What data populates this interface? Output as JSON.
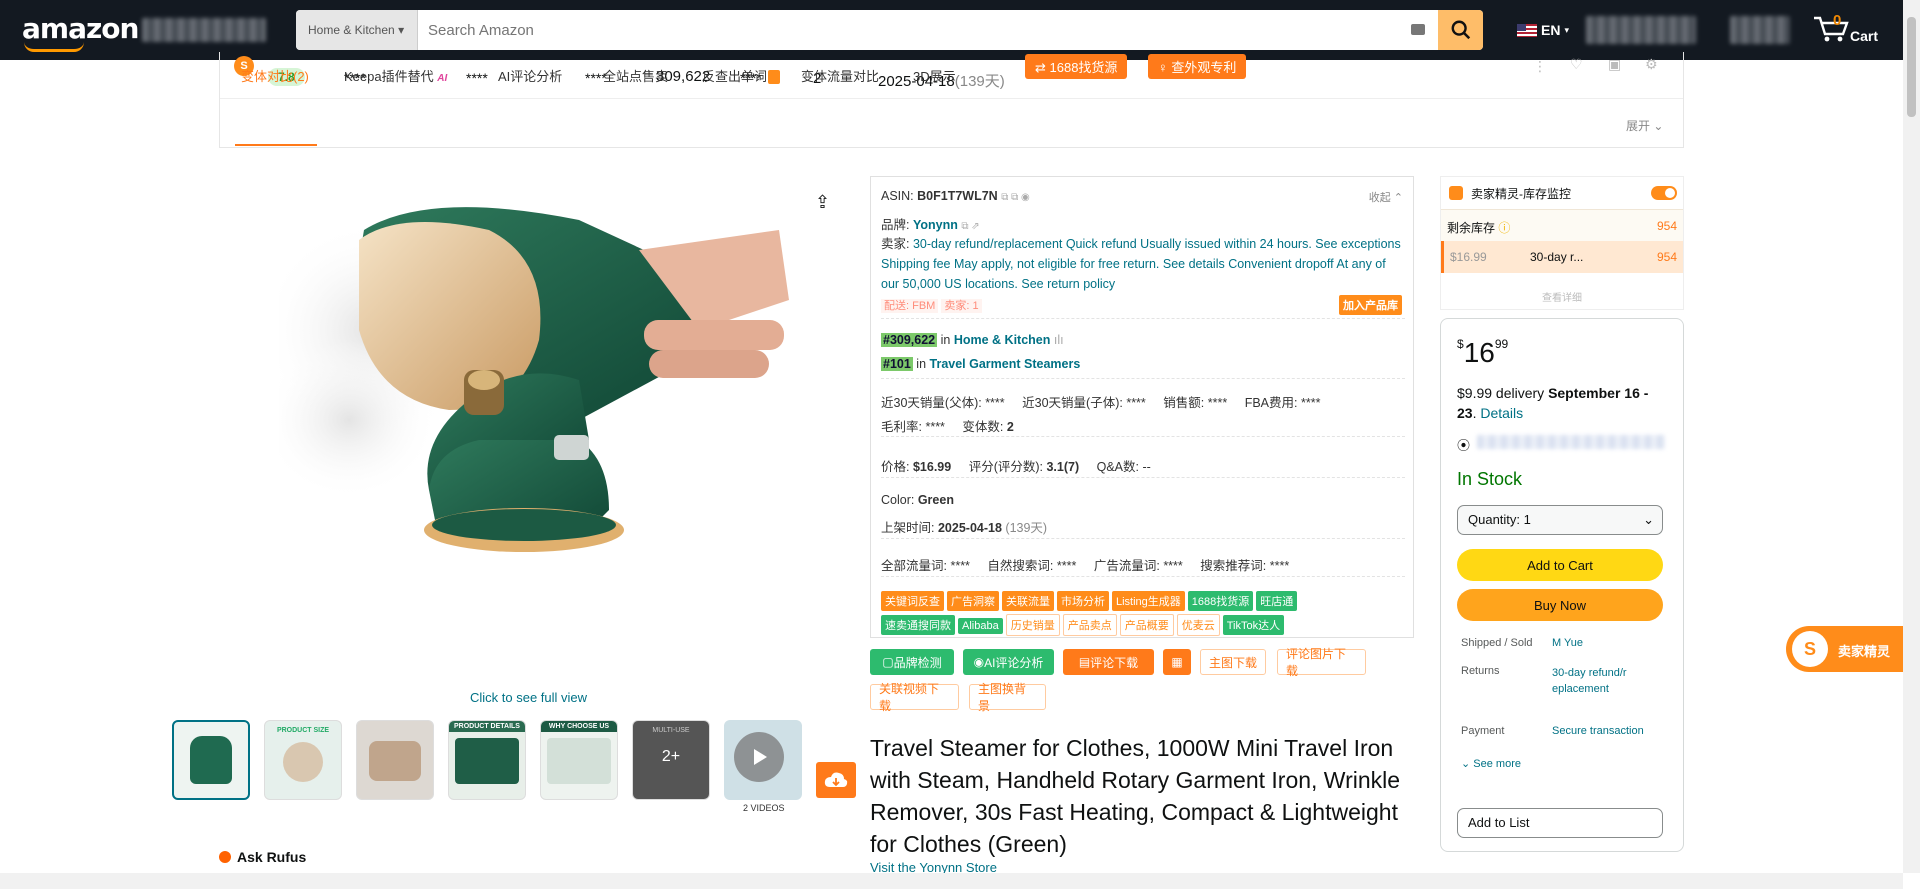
{
  "nav": {
    "logo": "amazon",
    "search_category": "Home & Kitchen",
    "search_placeholder": "Search Amazon",
    "language": "EN",
    "cart_count": "0",
    "cart_label": "Cart"
  },
  "plugin": {
    "score": "7.8",
    "stats": [
      "****",
      "****",
      "****",
      "309,622",
      "****",
      "2",
      "2025-04-18"
    ],
    "days_ago": "(139天)",
    "btn_1688": "1688找货源",
    "btn_patent": "查外观专利",
    "tabs": [
      "变体对比(2)",
      "Keepa插件替代",
      "AI评论分析",
      "全站点售卖",
      "反查出单词",
      "变体流量对比",
      "3D展示"
    ],
    "ai_badge": "AI",
    "expand": "展开"
  },
  "gallery": {
    "see_full": "Click to see full view",
    "thumbs": [
      "",
      "PRODUCT SIZE",
      "",
      "PRODUCT DETAILS",
      "WHY CHOOSE US",
      "MULTI-USE"
    ],
    "more": "2+",
    "videos": "2 VIDEOS",
    "ask_rufus": "Ask Rufus"
  },
  "info": {
    "asin_label": "ASIN:",
    "asin": "B0F1T7WL7N",
    "collapse": "收起",
    "brand_label": "品牌:",
    "brand": "Yonynn",
    "seller_label": "卖家:",
    "seller_text": "30-day refund/replacement Quick refund Usually issued within 24 hours. See exceptions Shipping fee May apply, not eligible for free return. See details Convenient dropoff At any of our 50,000 US locations. See return policy",
    "fulfill": "配送: FBM",
    "seller_count": "卖家: 1",
    "add_lib": "加入产品库",
    "rank1": "#309,622",
    "rank1_in": "in",
    "rank1_cat": "Home & Kitchen",
    "rank2": "#101",
    "rank2_in": "in",
    "rank2_cat": "Travel Garment Steamers",
    "sales_parent_label": "近30天销量(父体):",
    "sales_parent": "****",
    "sales_child_label": "近30天销量(子体):",
    "sales_child": "****",
    "revenue_label": "销售额:",
    "revenue": "****",
    "fba_label": "FBA费用:",
    "fba": "****",
    "margin_label": "毛利率:",
    "margin": "****",
    "variants_label": "变体数:",
    "variants": "2",
    "price_label": "价格:",
    "price": "$16.99",
    "rating_label": "评分(评分数):",
    "rating": "3.1(7)",
    "qa_label": "Q&A数:",
    "qa": "--",
    "color_label": "Color:",
    "color": "Green",
    "listed_label": "上架时间:",
    "listed": "2025-04-18",
    "listed_days": "(139天)",
    "all_traffic_label": "全部流量词:",
    "all_traffic": "****",
    "organic_label": "自然搜索词:",
    "organic": "****",
    "ad_label": "广告流量词:",
    "ad": "****",
    "rec_label": "搜索推荐词:",
    "rec": "****",
    "tags_row1": [
      "关键词反查",
      "广告洞察",
      "关联流量",
      "市场分析",
      "Listing生成器",
      "1688找货源",
      "旺店通"
    ],
    "tags_row2": [
      "速卖通搜同款",
      "Alibaba",
      "历史销量",
      "产品卖点",
      "产品概要",
      "优麦云",
      "TikTok达人"
    ]
  },
  "actions": {
    "brand_check": "品牌检测",
    "ai_review": "AI评论分析",
    "review_dl": "评论下载",
    "main_img_dl": "主图下载",
    "review_img_dl": "评论图片下载",
    "video_dl": "关联视频下载",
    "bg_swap": "主图换背景"
  },
  "product": {
    "title": "Travel Steamer for Clothes, 1000W Mini Travel Iron with Steam, Handheld Rotary Garment Iron, Wrinkle Remover, 30s Fast Heating, Compact & Lightweight for Clothes (Green)",
    "store_link": "Visit the Yonynn Store"
  },
  "stock": {
    "title": "卖家精灵-库存监控",
    "remaining_label": "剩余库存",
    "remaining": "954",
    "row_price": "$16.99",
    "row_text": "30-day r...",
    "row_qty": "954",
    "view_detail": "查看详细"
  },
  "buybox": {
    "currency": "$",
    "dollars": "16",
    "cents": "99",
    "delivery": "$9.99 delivery",
    "delivery_dates": "September 16 - 23",
    "details": "Details",
    "in_stock": "In Stock",
    "quantity_label": "Quantity:",
    "quantity": "1",
    "add_to_cart": "Add to Cart",
    "buy_now": "Buy Now",
    "shipped_label": "Shipped / Sold",
    "shipped_value": "M Yue",
    "returns_label": "Returns",
    "returns_value": "30-day refund/replacement",
    "payment_label": "Payment",
    "payment_value": "Secure transaction",
    "see_more": "See more",
    "add_to_list": "Add to List"
  },
  "float": {
    "label": "卖家精灵"
  },
  "colors": {
    "nav": "#131921",
    "accent": "#ff9900",
    "orange": "#ff7a1a",
    "green": "#2dbb6e",
    "link": "#007185",
    "cart_yellow": "#ffd814",
    "buy_orange": "#ffa41c"
  }
}
